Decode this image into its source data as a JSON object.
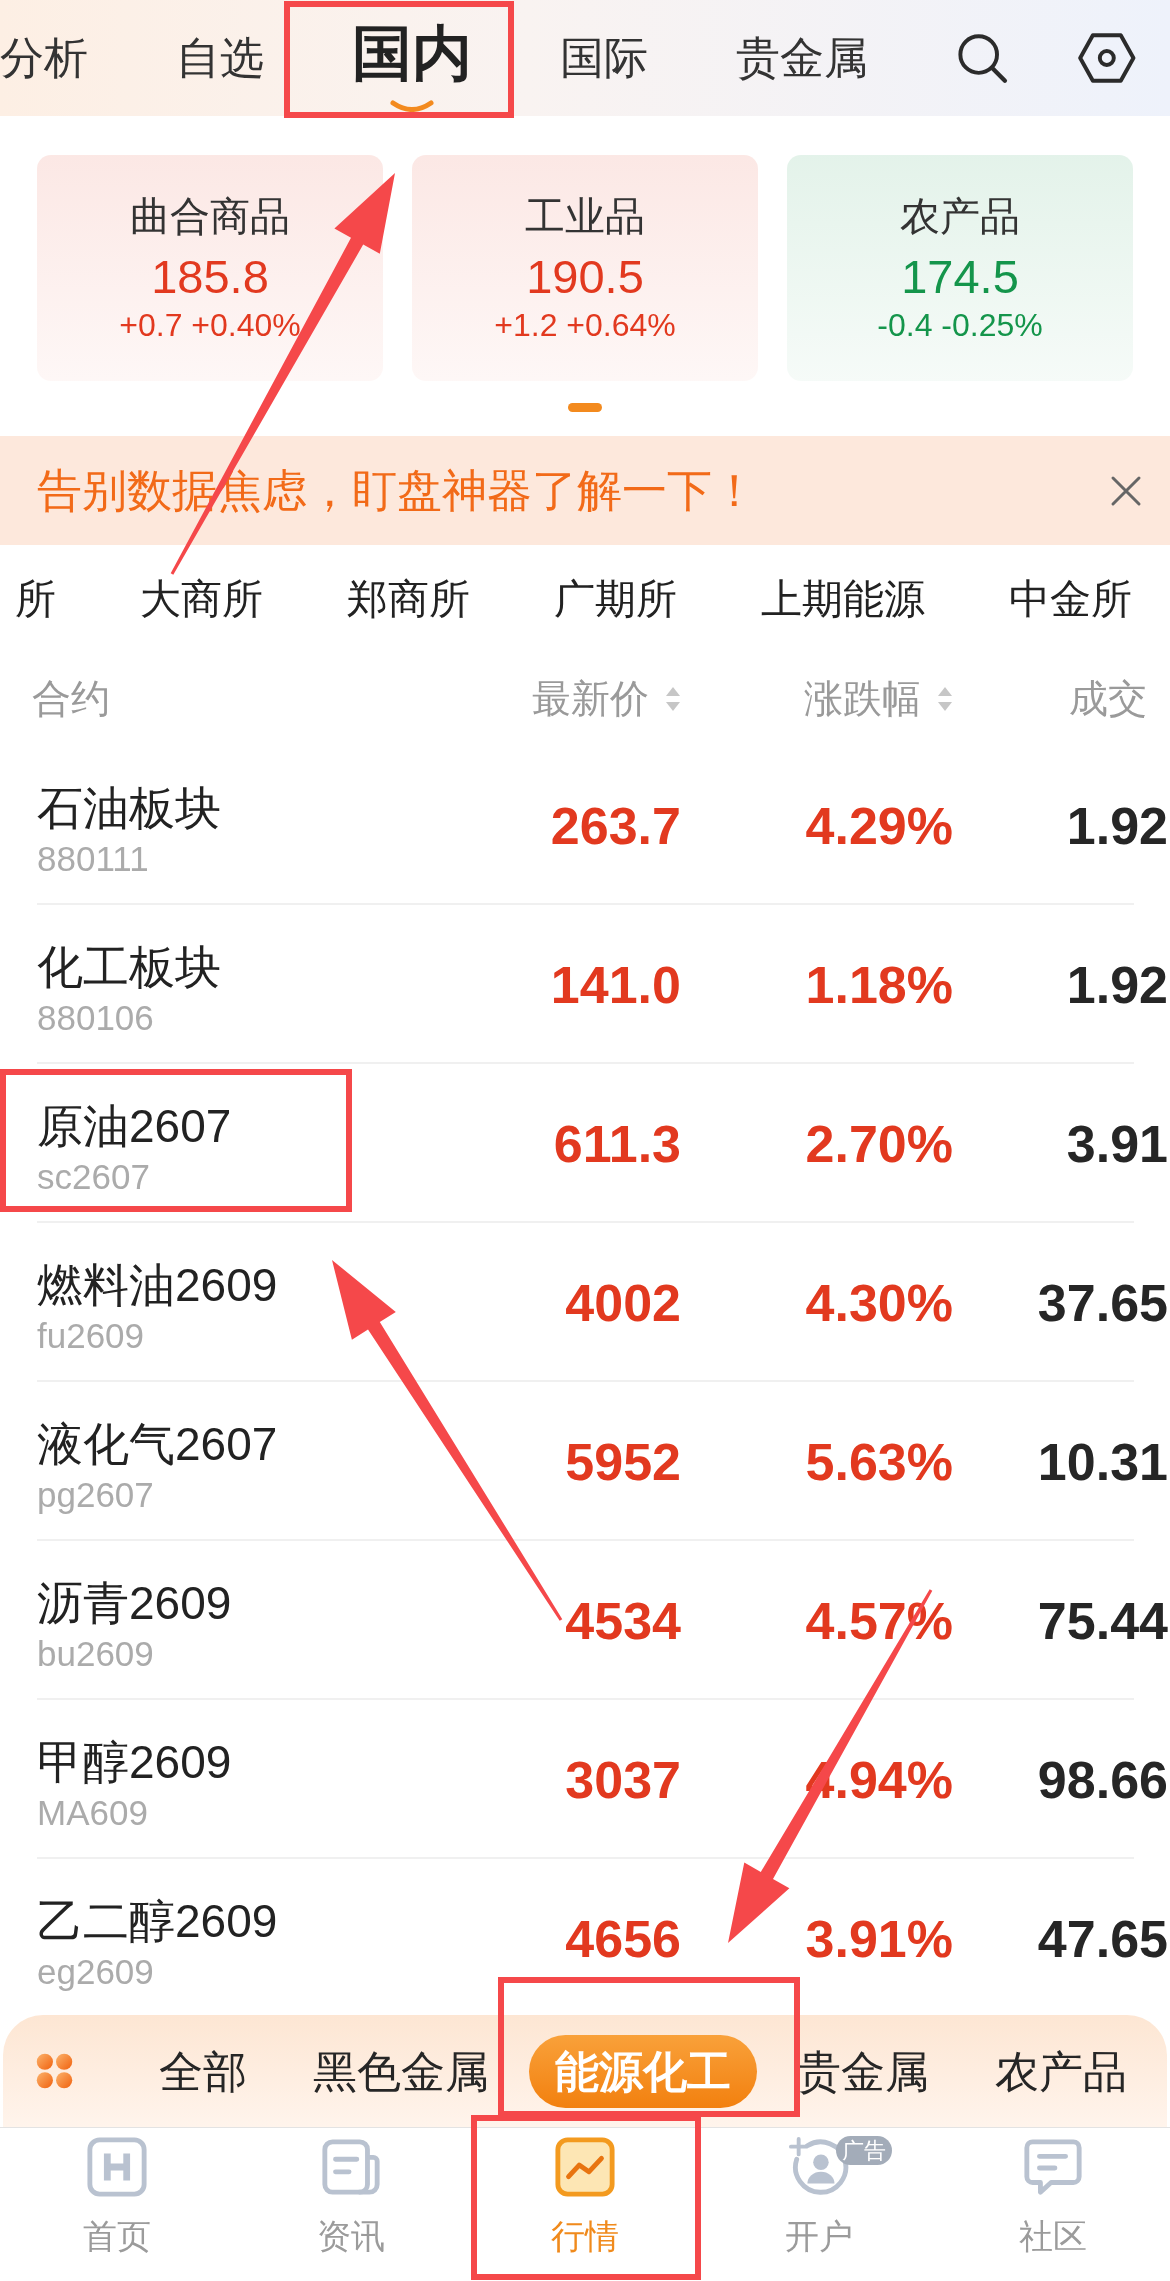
{
  "top_tabs": [
    {
      "label": "分析",
      "selected": false
    },
    {
      "label": "自选",
      "selected": false
    },
    {
      "label": "国内",
      "selected": true
    },
    {
      "label": "国际",
      "selected": false
    },
    {
      "label": "贵金属",
      "selected": false
    }
  ],
  "index_cards": [
    {
      "name": "曲合商品",
      "value": "185.8",
      "change": "+0.7 +0.40%",
      "color": "#e2391f"
    },
    {
      "name": "工业品",
      "value": "190.5",
      "change": "+1.2 +0.64%",
      "color": "#e2391f"
    },
    {
      "name": "农产品",
      "value": "174.5",
      "change": "-0.4 -0.25%",
      "color": "#14954b"
    }
  ],
  "banner": {
    "text": "告别数据焦虑，盯盘神器了解一下！"
  },
  "exchanges": [
    "所",
    "大商所",
    "郑商所",
    "广期所",
    "上期能源",
    "中金所"
  ],
  "table": {
    "columns": [
      {
        "label": "合约",
        "sortable": false
      },
      {
        "label": "最新价",
        "sortable": true
      },
      {
        "label": "涨跌幅",
        "sortable": true
      },
      {
        "label": "成交",
        "sortable": false
      }
    ],
    "rows": [
      {
        "name": "石油板块",
        "code": "880111",
        "price": "263.7",
        "change": "4.29%",
        "volume": "1.92"
      },
      {
        "name": "化工板块",
        "code": "880106",
        "price": "141.0",
        "change": "1.18%",
        "volume": "1.92"
      },
      {
        "name": "原油2607",
        "code": "sc2607",
        "price": "611.3",
        "change": "2.70%",
        "volume": "3.91"
      },
      {
        "name": "燃料油2609",
        "code": "fu2609",
        "price": "4002",
        "change": "4.30%",
        "volume": "37.65"
      },
      {
        "name": "液化气2607",
        "code": "pg2607",
        "price": "5952",
        "change": "5.63%",
        "volume": "10.31"
      },
      {
        "name": "沥青2609",
        "code": "bu2609",
        "price": "4534",
        "change": "4.57%",
        "volume": "75.44"
      },
      {
        "name": "甲醇2609",
        "code": "MA609",
        "price": "3037",
        "change": "4.94%",
        "volume": "98.66"
      },
      {
        "name": "乙二醇2609",
        "code": "eg2609",
        "price": "4656",
        "change": "3.91%",
        "volume": "47.65"
      }
    ]
  },
  "categories": [
    {
      "label": "全部",
      "selected": false
    },
    {
      "label": "黑色金属",
      "selected": false
    },
    {
      "label": "能源化工",
      "selected": true
    },
    {
      "label": "贵金属",
      "selected": false
    },
    {
      "label": "农产品",
      "selected": false
    }
  ],
  "bottom_nav": [
    {
      "label": "首页",
      "kind": "home",
      "selected": false
    },
    {
      "label": "资讯",
      "kind": "news",
      "selected": false
    },
    {
      "label": "行情",
      "kind": "market",
      "selected": true
    },
    {
      "label": "开户",
      "kind": "account",
      "selected": false,
      "badge": "广告"
    },
    {
      "label": "社区",
      "kind": "community",
      "selected": false
    }
  ]
}
